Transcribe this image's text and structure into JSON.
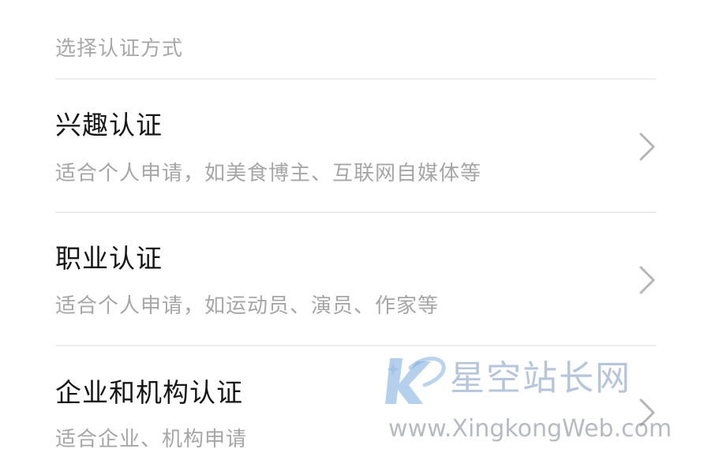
{
  "section_header": "选择认证方式",
  "options": [
    {
      "title": "兴趣认证",
      "description": "适合个人申请，如美食博主、互联网自媒体等",
      "chevron_icon": "chevron-right-icon"
    },
    {
      "title": "职业认证",
      "description": "适合个人申请，如运动员、演员、作家等",
      "chevron_icon": "chevron-right-icon"
    },
    {
      "title": "企业和机构认证",
      "description": "适合企业、机构申请",
      "chevron_icon": "chevron-right-icon"
    }
  ],
  "watermark": {
    "name": "星空站长网",
    "url": "www.XingkongWeb.com",
    "logo_icon": "xingkong-logo-icon"
  },
  "colors": {
    "background": "#ffffff",
    "title_text": "#161616",
    "secondary_text": "#a6a6a6",
    "divider": "#ececec",
    "chevron": "#b5b5b5"
  }
}
